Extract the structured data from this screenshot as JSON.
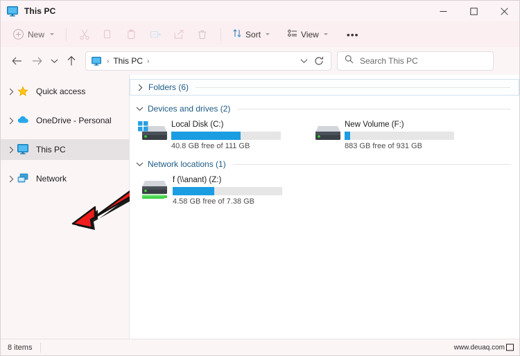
{
  "window": {
    "title": "This PC",
    "title_icon": "this-pc-monitor-icon",
    "controls": {
      "minimize": "—",
      "maximize": "□",
      "close": "✕"
    }
  },
  "toolbar": {
    "new_label": "New",
    "new_icon": "plus-circle-icon",
    "cut_icon": "scissors-icon",
    "copy_icon": "copy-icon",
    "paste_icon": "clipboard-paste-icon",
    "rename_icon": "rename-icon",
    "share_icon": "share-icon",
    "delete_icon": "trash-icon",
    "sort_label": "Sort",
    "sort_icon": "sort-arrows-icon",
    "view_label": "View",
    "view_icon": "view-list-icon",
    "more_label": "•••"
  },
  "address_bar": {
    "back_icon": "arrow-left-icon",
    "forward_icon": "arrow-right-icon",
    "recent_icon": "chevron-down-icon",
    "up_icon": "arrow-up-icon",
    "path_icon": "this-pc-monitor-icon",
    "crumbs": [
      "This PC"
    ],
    "dropdown_icon": "chevron-down-icon",
    "refresh_icon": "refresh-icon"
  },
  "search": {
    "icon": "search-icon",
    "placeholder": "Search This PC",
    "value": ""
  },
  "sidebar": {
    "items": [
      {
        "label": "Quick access",
        "icon": "star-icon",
        "selected": false
      },
      {
        "label": "OneDrive - Personal",
        "icon": "cloud-icon",
        "selected": false
      },
      {
        "label": "This PC",
        "icon": "this-pc-monitor-icon",
        "selected": true
      },
      {
        "label": "Network",
        "icon": "network-icon",
        "selected": false
      }
    ]
  },
  "content": {
    "groups": [
      {
        "title": "Folders (6)",
        "expanded": false,
        "focused": true,
        "items": []
      },
      {
        "title": "Devices and drives (2)",
        "expanded": true,
        "focused": false,
        "items": [
          {
            "name": "Local Disk (C:)",
            "icon": "hard-drive-windows-icon",
            "free": "40.8 GB",
            "total": "111 GB",
            "sub": "40.8 GB free of 111 GB",
            "used_percent": 63
          },
          {
            "name": "New Volume (F:)",
            "icon": "hard-drive-icon",
            "free": "883 GB",
            "total": "931 GB",
            "sub": "883 GB free of 931 GB",
            "used_percent": 5
          }
        ]
      },
      {
        "title": "Network locations (1)",
        "expanded": true,
        "focused": false,
        "items": [
          {
            "name": "f (\\\\anant) (Z:)",
            "icon": "network-drive-icon",
            "free": "4.58 GB",
            "total": "7.38 GB",
            "sub": "4.58 GB free of 7.38 GB",
            "used_percent": 38
          }
        ]
      }
    ]
  },
  "status_bar": {
    "item_count": "8 items",
    "watermark": "www.deuaq.com",
    "watermark_icon": "monitor-icon"
  },
  "annotation": {
    "arrow": "red-arrow-pointing-to-this-pc",
    "color": "#ee1c1c"
  },
  "colors": {
    "accent_blue": "#1b9de2",
    "group_header_text": "#1e5b86",
    "selected_row": "#e6e2e3",
    "toolbar_bg": "#fbeff1",
    "window_bg": "#fbf5f6"
  }
}
